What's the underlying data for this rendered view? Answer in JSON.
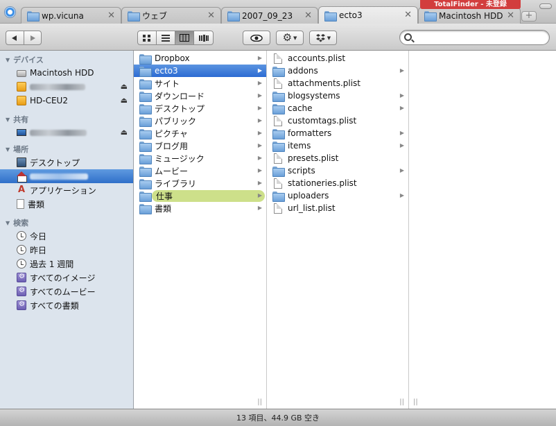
{
  "tabs": [
    {
      "label": "wp.vicuna"
    },
    {
      "label": "ウェブ"
    },
    {
      "label": "2007_09_23"
    },
    {
      "label": "ecto3"
    },
    {
      "label": "Macintosh HDD"
    }
  ],
  "badge": "TotalFinder - 未登録",
  "new_tab_label": "+",
  "search": {
    "placeholder": "",
    "value": ""
  },
  "sidebar": {
    "devices": {
      "title": "デバイス",
      "items": [
        {
          "label": "Macintosh HDD",
          "icon": "hard-drive-icon"
        },
        {
          "label": "",
          "icon": "external-drive-icon",
          "blurred": true
        },
        {
          "label": "HD-CEU2",
          "icon": "external-drive-icon"
        }
      ]
    },
    "shared": {
      "title": "共有",
      "items": [
        {
          "label": "",
          "icon": "computer-icon",
          "blurred": true
        }
      ]
    },
    "places": {
      "title": "場所",
      "items": [
        {
          "label": "デスクトップ",
          "icon": "desktop-icon"
        },
        {
          "label": "",
          "icon": "home-icon",
          "blurred": true,
          "selected": true
        },
        {
          "label": "アプリケーション",
          "icon": "applications-icon"
        },
        {
          "label": "書類",
          "icon": "documents-icon"
        }
      ]
    },
    "search": {
      "title": "検索",
      "items": [
        {
          "label": "今日",
          "icon": "clock-icon"
        },
        {
          "label": "昨日",
          "icon": "clock-icon"
        },
        {
          "label": "過去 1 週間",
          "icon": "clock-icon"
        },
        {
          "label": "すべてのイメージ",
          "icon": "smart-folder-icon"
        },
        {
          "label": "すべてのムービー",
          "icon": "smart-folder-icon"
        },
        {
          "label": "すべての書類",
          "icon": "smart-folder-icon"
        }
      ]
    }
  },
  "columns": {
    "home": [
      {
        "label": "Dropbox",
        "has_children": true
      },
      {
        "label": "ecto3",
        "has_children": true,
        "selected": true
      },
      {
        "label": "サイト",
        "has_children": true
      },
      {
        "label": "ダウンロード",
        "has_children": true
      },
      {
        "label": "デスクトップ",
        "has_children": true
      },
      {
        "label": "パブリック",
        "has_children": true
      },
      {
        "label": "ピクチャ",
        "has_children": true
      },
      {
        "label": "ブログ用",
        "has_children": true
      },
      {
        "label": "ミュージック",
        "has_children": true
      },
      {
        "label": "ムービー",
        "has_children": true
      },
      {
        "label": "ライブラリ",
        "has_children": true
      },
      {
        "label": "仕事",
        "has_children": true,
        "tagged": true
      },
      {
        "label": "書類",
        "has_children": true
      }
    ],
    "ecto3": [
      {
        "label": "accounts.plist",
        "kind": "file"
      },
      {
        "label": "addons",
        "kind": "folder",
        "has_children": true
      },
      {
        "label": "attachments.plist",
        "kind": "file"
      },
      {
        "label": "blogsystems",
        "kind": "folder",
        "has_children": true
      },
      {
        "label": "cache",
        "kind": "folder",
        "has_children": true
      },
      {
        "label": "customtags.plist",
        "kind": "file"
      },
      {
        "label": "formatters",
        "kind": "folder",
        "has_children": true
      },
      {
        "label": "items",
        "kind": "folder",
        "has_children": true
      },
      {
        "label": "presets.plist",
        "kind": "file"
      },
      {
        "label": "scripts",
        "kind": "folder",
        "has_children": true
      },
      {
        "label": "stationeries.plist",
        "kind": "file"
      },
      {
        "label": "uploaders",
        "kind": "folder",
        "has_children": true
      },
      {
        "label": "url_list.plist",
        "kind": "file"
      }
    ]
  },
  "status": "13 項目、44.9 GB 空き",
  "colors": {
    "selection": "#3a78d6",
    "tag_green": "#cde08a",
    "badge_red": "#d23d3d",
    "sidebar_bg": "#dce4ed"
  }
}
